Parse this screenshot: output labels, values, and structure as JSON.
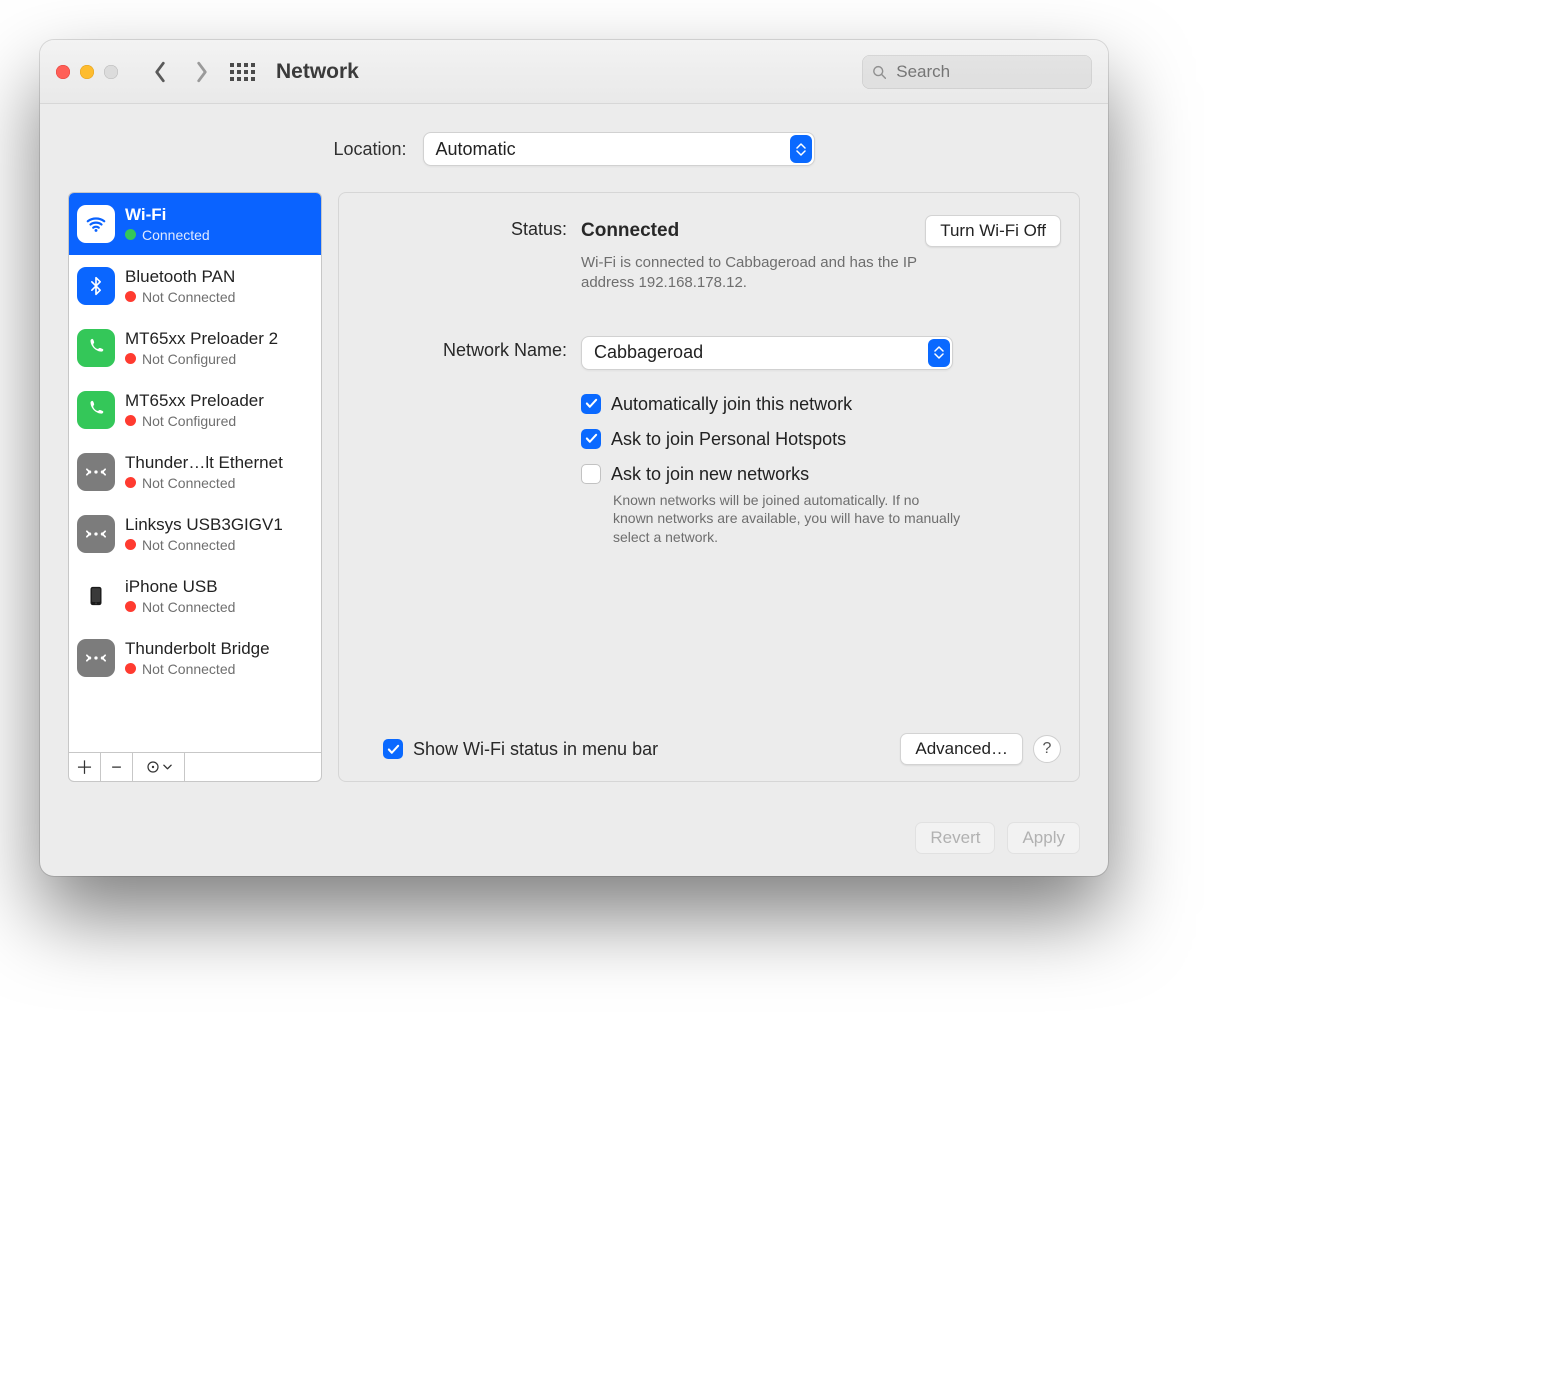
{
  "window": {
    "title": "Network",
    "search_placeholder": "Search"
  },
  "location": {
    "label": "Location:",
    "value": "Automatic"
  },
  "sidebar": {
    "items": [
      {
        "name": "Wi-Fi",
        "status": "Connected",
        "color": "green",
        "icon": "wifi",
        "selected": true
      },
      {
        "name": "Bluetooth PAN",
        "status": "Not Connected",
        "color": "red",
        "icon": "bt"
      },
      {
        "name": "MT65xx Preloader 2",
        "status": "Not Configured",
        "color": "red",
        "icon": "phone"
      },
      {
        "name": "MT65xx Preloader",
        "status": "Not Configured",
        "color": "red",
        "icon": "phone"
      },
      {
        "name": "Thunder…lt Ethernet",
        "status": "Not Connected",
        "color": "red",
        "icon": "eth"
      },
      {
        "name": "Linksys USB3GIGV1",
        "status": "Not Connected",
        "color": "red",
        "icon": "eth"
      },
      {
        "name": "iPhone USB",
        "status": "Not Connected",
        "color": "red",
        "icon": "iphone"
      },
      {
        "name": "Thunderbolt Bridge",
        "status": "Not Connected",
        "color": "red",
        "icon": "eth"
      }
    ]
  },
  "main": {
    "status_label": "Status:",
    "status_value": "Connected",
    "toggle_label": "Turn Wi-Fi Off",
    "status_desc": "Wi-Fi is connected to Cabbageroad and has the IP address 192.168.178.12.",
    "network_label": "Network Name:",
    "network_value": "Cabbageroad",
    "checks": [
      {
        "label": "Automatically join this network",
        "checked": true
      },
      {
        "label": "Ask to join Personal Hotspots",
        "checked": true
      },
      {
        "label": "Ask to join new networks",
        "checked": false,
        "desc": "Known networks will be joined automatically. If no known networks are available, you will have to manually select a network."
      }
    ],
    "menubar_label": "Show Wi-Fi status in menu bar",
    "menubar_checked": true,
    "advanced_label": "Advanced…",
    "help_label": "?"
  },
  "footer": {
    "revert": "Revert",
    "apply": "Apply"
  }
}
